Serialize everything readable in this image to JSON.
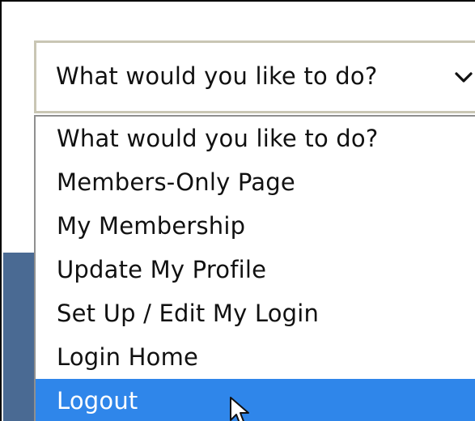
{
  "select": {
    "current_value": "What would you like to do?",
    "chevron_icon": "chevron-down-icon"
  },
  "dropdown": {
    "options": [
      {
        "label": "What would you like to do?"
      },
      {
        "label": "Members-Only Page"
      },
      {
        "label": "My Membership"
      },
      {
        "label": "Update My Profile"
      },
      {
        "label": "Set Up / Edit My Login"
      },
      {
        "label": "Login Home"
      },
      {
        "label": "Logout",
        "highlighted": true
      }
    ]
  },
  "cursor": {
    "icon": "mouse-pointer-icon"
  },
  "colors": {
    "highlight": "#2f86ea",
    "page_background_band": "#4a6a93",
    "select_border": "#c9c6b4"
  }
}
